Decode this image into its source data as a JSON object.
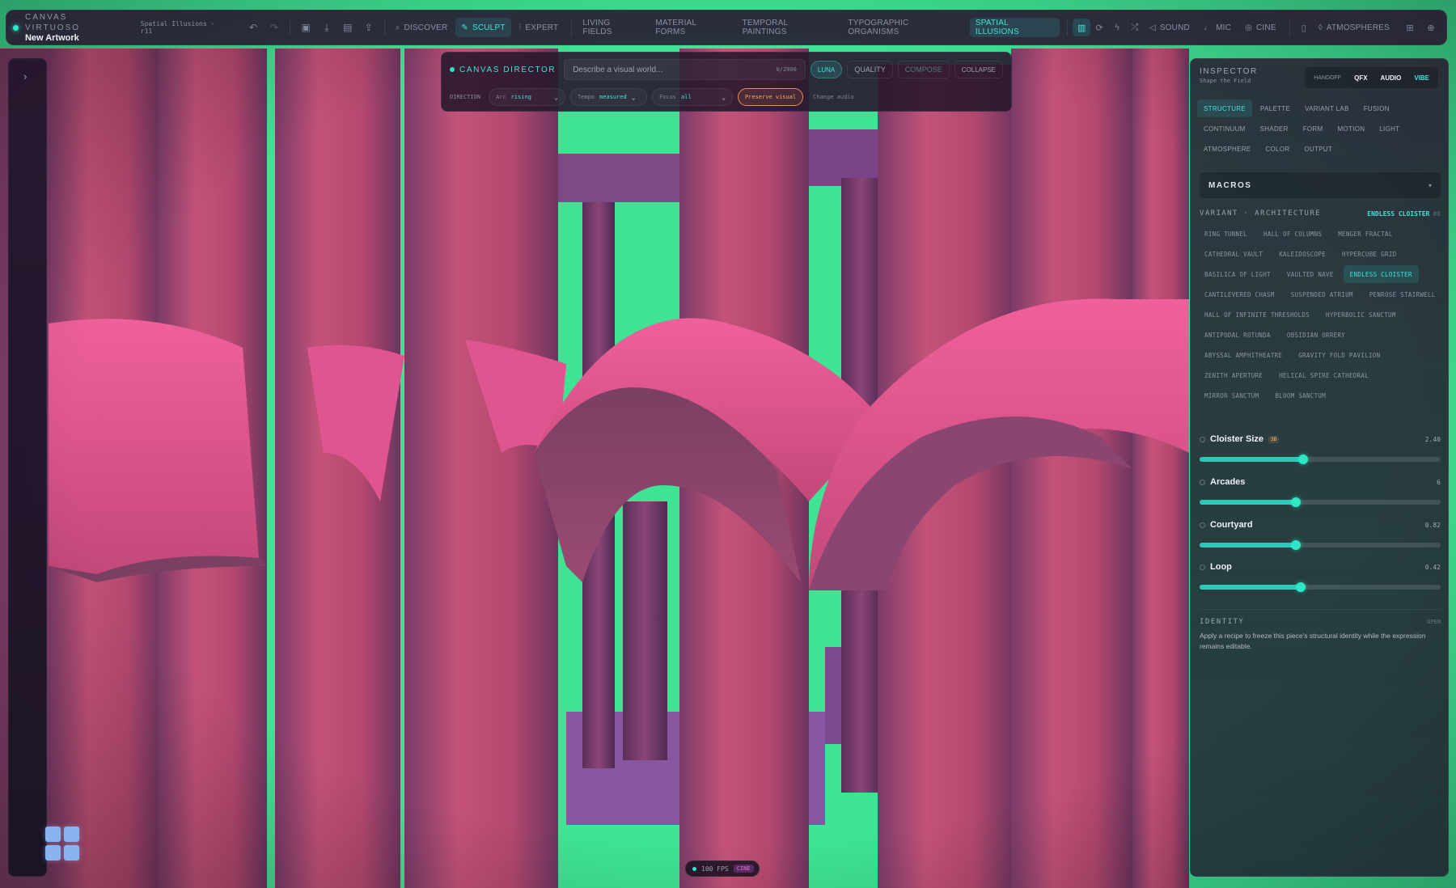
{
  "app": {
    "name": "CANVAS VIRTUOSO",
    "document": "New Artwork",
    "project": "Spatial Illusions · r11"
  },
  "toolbar": {
    "discover": "DISCOVER",
    "sculpt": "SCULPT",
    "expert": "EXPERT",
    "categories": [
      "LIVING FIELDS",
      "MATERIAL FORMS",
      "TEMPORAL PAINTINGS",
      "TYPOGRAPHIC ORGANISMS",
      "SPATIAL ILLUSIONS"
    ],
    "active_category": "SPATIAL ILLUSIONS",
    "sound": "SOUND",
    "mic": "MIC",
    "cine": "CINE",
    "atmospheres": "ATMOSPHERES"
  },
  "director": {
    "title": "CANVAS DIRECTOR",
    "placeholder": "Describe a visual world...",
    "count": "0/2000",
    "luna": "LUNA",
    "quality": "QUALITY",
    "compose": "COMPOSE",
    "collapse": "COLLAPSE",
    "direction_label": "DIRECTION",
    "arc_label": "Arc",
    "arc_value": "rising",
    "tempo_label": "Tempo",
    "tempo_value": "measured",
    "focus_label": "Focus",
    "focus_value": "all",
    "preserve": "Preserve visual",
    "change_audio": "Change audio"
  },
  "inspector": {
    "title": "INSPECTOR",
    "subtitle": "Shape the Field",
    "modes": [
      "HANDOFF",
      "QFX",
      "AUDIO",
      "VIBE"
    ],
    "active_mode": "VIBE",
    "tabs": [
      "STRUCTURE",
      "PALETTE",
      "VARIANT LAB",
      "FUSION",
      "CONTINUUM",
      "SHADER",
      "FORM",
      "MOTION",
      "LIGHT",
      "ATMOSPHERE",
      "COLOR",
      "OUTPUT"
    ],
    "active_tab": "STRUCTURE",
    "macros": "MACROS",
    "variant_title": "VARIANT · ARCHITECTURE",
    "variant_current": "ENDLESS CLOISTER",
    "variant_num": "#8",
    "variants": [
      "RING TUNNEL",
      "HALL OF COLUMNS",
      "MENGER FRACTAL",
      "CATHEDRAL VAULT",
      "KALEIDOSCOPE",
      "HYPERCUBE GRID",
      "BASILICA OF LIGHT",
      "VAULTED NAVE",
      "ENDLESS CLOISTER",
      "CANTILEVERED CHASM",
      "SUSPENDED ATRIUM",
      "PENROSE STAIRWELL",
      "HALL OF INFINITE THRESHOLDS",
      "HYPERBOLIC SANCTUM",
      "ANTIPODAL ROTUNDA",
      "OBSIDIAN ORRERY",
      "ABYSSAL AMPHITHEATRE",
      "GRAVITY FOLD PAVILION",
      "ZENITH APERTURE",
      "HELICAL SPIRE CATHEDRAL",
      "MIRROR SANCTUM",
      "BLOOM SANCTUM"
    ],
    "params": [
      {
        "label": "Cloister Size",
        "value": "2.40",
        "badge": "3D",
        "fraction": 0.43
      },
      {
        "label": "Arcades",
        "value": "6",
        "badge": "",
        "fraction": 0.4
      },
      {
        "label": "Courtyard",
        "value": "0.82",
        "badge": "",
        "fraction": 0.4
      },
      {
        "label": "Loop",
        "value": "0.42",
        "badge": "",
        "fraction": 0.42
      }
    ],
    "identity_title": "IDENTITY",
    "identity_open": "OPEN",
    "identity_desc": "Apply a recipe to freeze this piece's structural identity while the expression remains editable."
  },
  "status": {
    "fps": "100 FPS",
    "mode": "CINE"
  },
  "colors": {
    "accent": "#2ee6c8",
    "pillar": "#c94f7a",
    "arch": "#e0558f",
    "glow": "#3ee08a"
  }
}
